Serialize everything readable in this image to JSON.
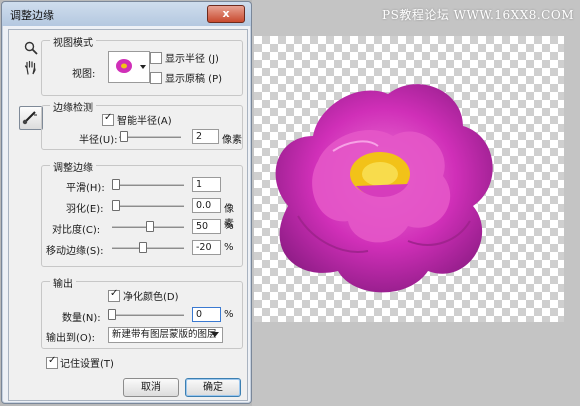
{
  "watermark": "PS教程论坛 WWW.16XX8.COM",
  "dialog": {
    "title": "调整边缘",
    "close_label": "x"
  },
  "tools": {
    "zoom_icon": "zoom-icon",
    "hand_icon": "hand-icon",
    "refine_icon": "refine-radius-brush-icon"
  },
  "view_mode": {
    "legend": "视图模式",
    "view_label": "视图:",
    "show_radius_label": "显示半径 (J)",
    "show_radius_checked": false,
    "show_original_label": "显示原稿 (P)",
    "show_original_checked": false
  },
  "edge_detection": {
    "legend": "边缘检测",
    "smart_radius_label": "智能半径(A)",
    "smart_radius_checked": true,
    "radius_label": "半径(U):",
    "radius_value": "2",
    "radius_unit": "像素",
    "radius_slider": 0.04
  },
  "adjust_edge": {
    "legend": "调整边缘",
    "smooth_label": "平滑(H):",
    "smooth_value": "1",
    "smooth_slider": 0.01,
    "feather_label": "羽化(E):",
    "feather_value": "0.0",
    "feather_unit": "像素",
    "feather_slider": 0.0,
    "contrast_label": "对比度(C):",
    "contrast_value": "50",
    "contrast_unit": "%",
    "contrast_slider": 0.5,
    "shift_label": "移动边缘(S):",
    "shift_value": "-20",
    "shift_unit": "%",
    "shift_slider": 0.4
  },
  "output": {
    "legend": "输出",
    "decontaminate_label": "净化颜色(D)",
    "decontaminate_checked": true,
    "amount_label": "数量(N):",
    "amount_value": "0",
    "amount_unit": "%",
    "amount_slider": 0.0,
    "output_to_label": "输出到(O):",
    "output_to_value": "新建带有图层蒙版的图层"
  },
  "remember_label": "记住设置(T)",
  "remember_checked": true,
  "cancel_label": "取消",
  "ok_label": "确定",
  "colors": {
    "flower": "#d02fb8",
    "flower_center": "#f2c218",
    "title_bar": "#c2d3e8"
  }
}
